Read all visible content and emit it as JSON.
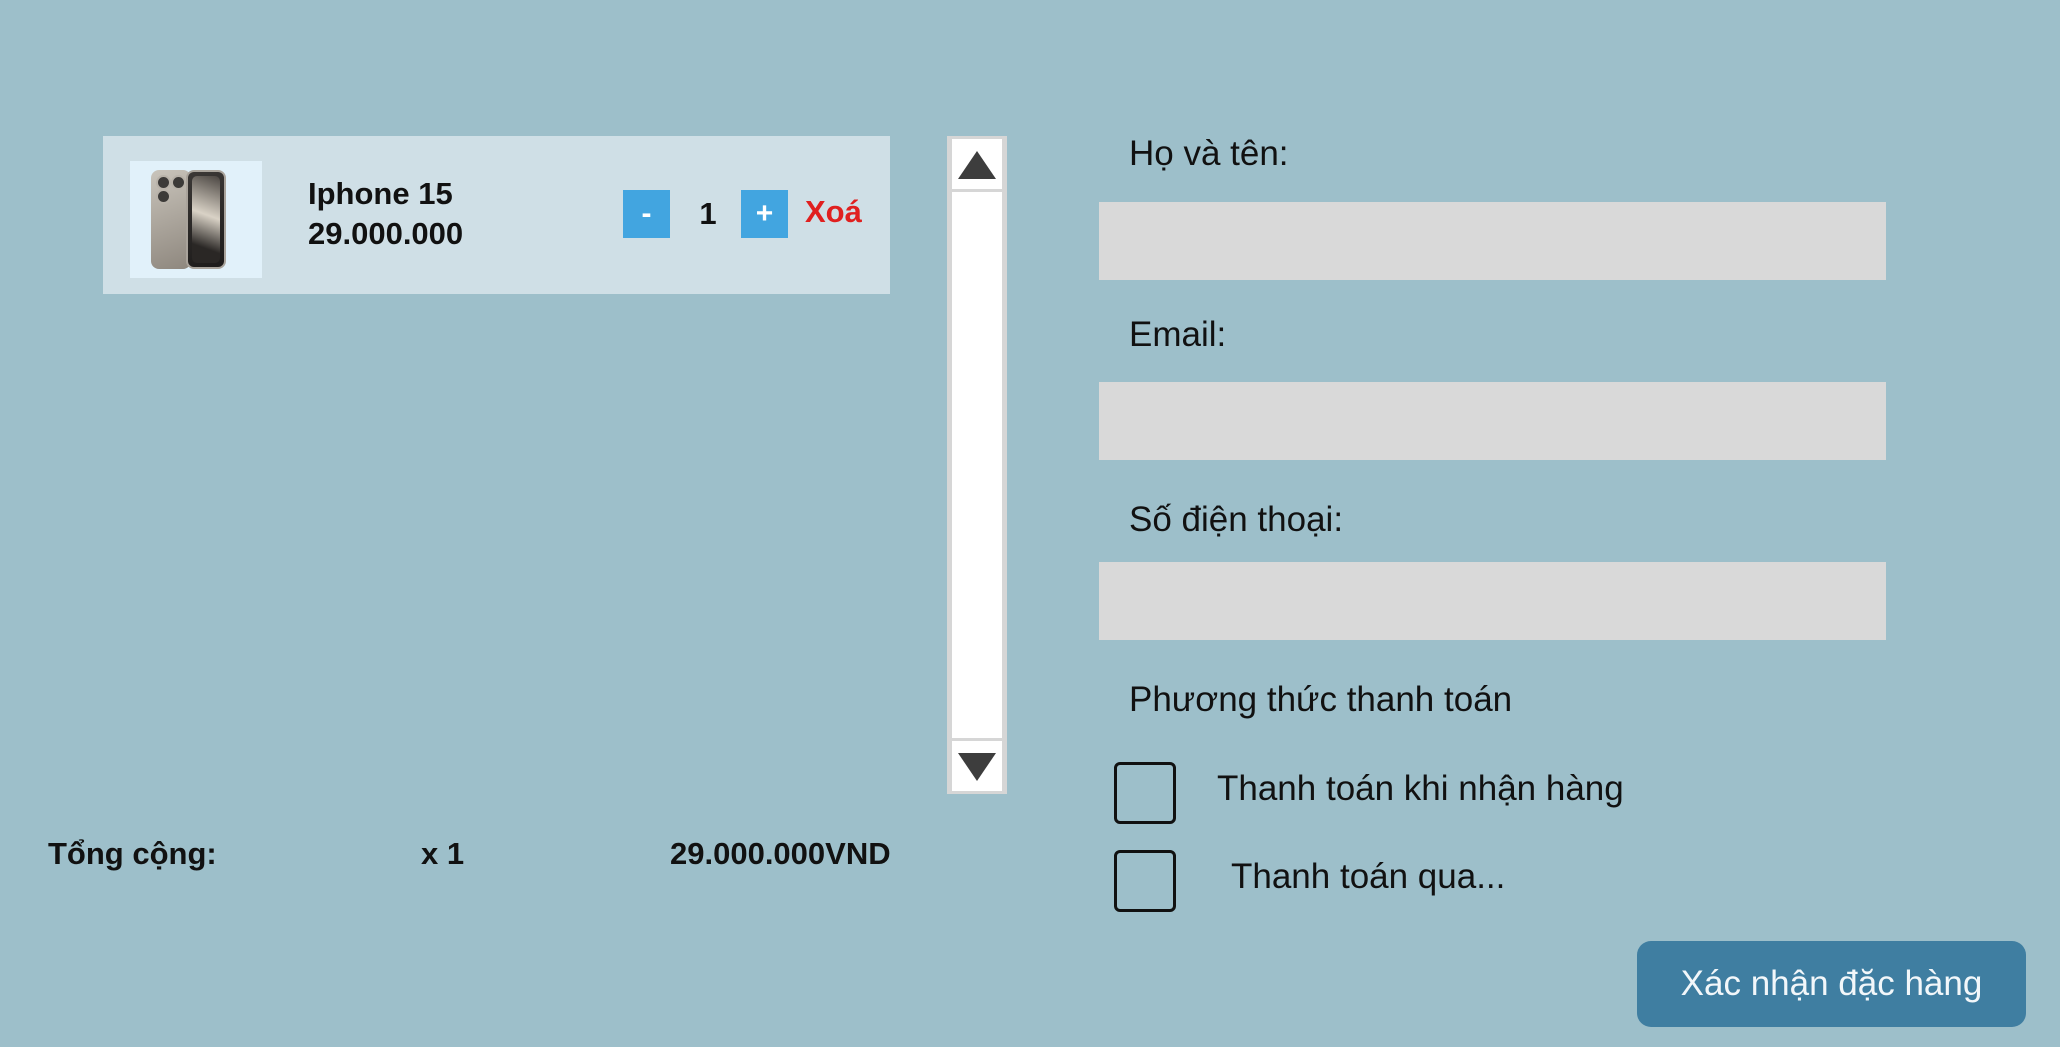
{
  "cart": {
    "items": [
      {
        "name": "Iphone 15",
        "price": "29.000.000",
        "quantity": "1",
        "minus_label": "-",
        "plus_label": "+",
        "delete_label": "Xoá",
        "image_icon": "iphone-15-image"
      }
    ]
  },
  "scrollbar": {
    "up_icon": "triangle-up-icon",
    "down_icon": "triangle-down-icon"
  },
  "total": {
    "label": "Tổng cộng:",
    "count": "x 1",
    "amount": "29.000.000VND"
  },
  "form": {
    "name_label": "Họ và tên:",
    "name_value": "",
    "email_label": "Email:",
    "email_value": "",
    "phone_label": "Số điện thoại:",
    "phone_value": "",
    "payment_label": "Phương thức thanh toán",
    "payment_options": [
      {
        "label": "Thanh toán khi nhận hàng",
        "checked": false
      },
      {
        "label": "Thanh toán qua...",
        "checked": false
      }
    ],
    "confirm_label": "Xác nhận đặc hàng"
  },
  "colors": {
    "background": "#9dbfca",
    "card": "#cfdfe6",
    "qty_button": "#42a5e0",
    "delete": "#e0201f",
    "input": "#d9d9d9",
    "confirm_button": "#3f7ea1"
  }
}
